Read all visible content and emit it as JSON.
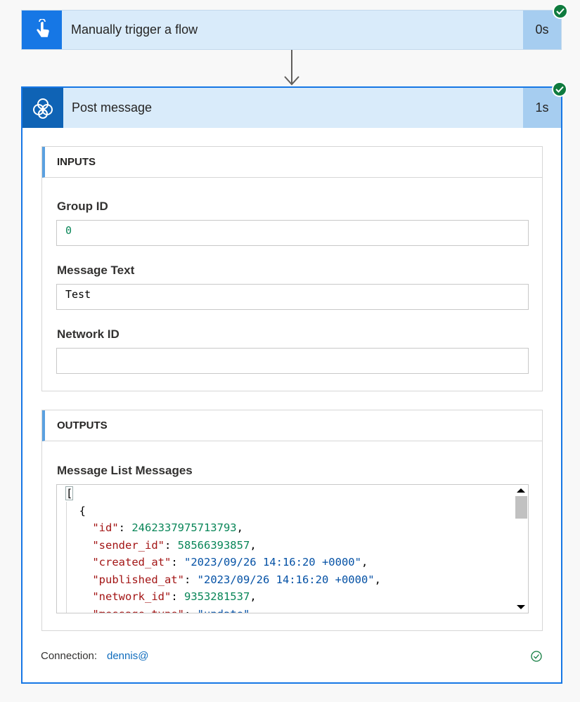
{
  "trigger": {
    "title": "Manually trigger a flow",
    "duration": "0s",
    "icon": "touch-hand-icon",
    "status": "succeeded"
  },
  "action": {
    "title": "Post message",
    "duration": "1s",
    "icon": "yammer-icon",
    "status": "succeeded",
    "inputs": {
      "heading": "INPUTS",
      "fields": [
        {
          "label": "Group ID",
          "value": "0"
        },
        {
          "label": "Message Text",
          "value": "Test"
        },
        {
          "label": "Network ID",
          "value": ""
        }
      ]
    },
    "outputs": {
      "heading": "OUTPUTS",
      "field_label": "Message List Messages",
      "json_lines": [
        {
          "t": "["
        },
        {
          "t": "  {"
        },
        {
          "key": "id",
          "val": "2462337975713793",
          "type": "n"
        },
        {
          "key": "sender_id",
          "val": "58566393857",
          "type": "n"
        },
        {
          "key": "created_at",
          "val": "\"2023/09/26 14:16:20 +0000\"",
          "type": "s"
        },
        {
          "key": "published_at",
          "val": "\"2023/09/26 14:16:20 +0000\"",
          "type": "s"
        },
        {
          "key": "network_id",
          "val": "9353281537",
          "type": "n"
        },
        {
          "key": "message_type",
          "val": "\"update\"",
          "type": "s"
        }
      ]
    },
    "connection": {
      "label": "Connection:",
      "value": "dennis@"
    }
  },
  "colors": {
    "accent": "#1677e5",
    "success": "#0f7b3e",
    "header_bg": "#d9ebfa",
    "duration_bg": "#a6cdf0"
  }
}
